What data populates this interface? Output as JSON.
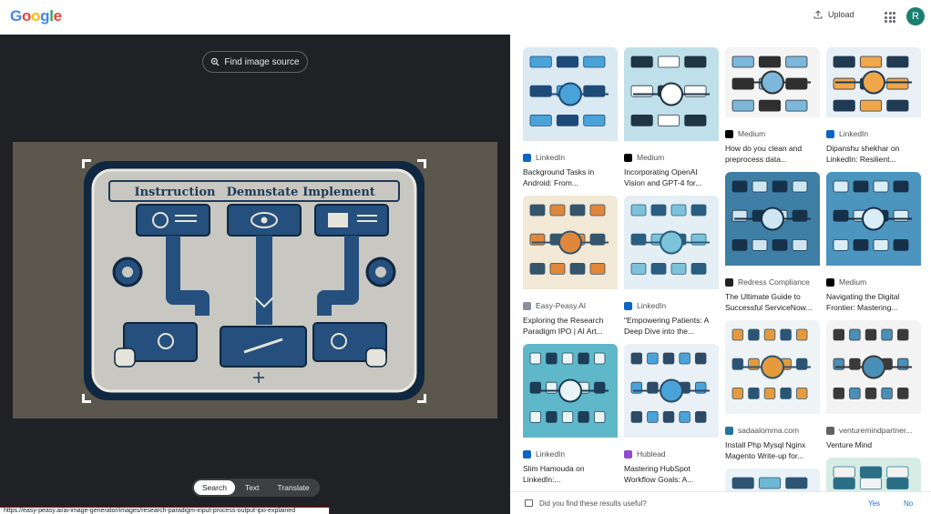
{
  "header": {
    "logo_letters": [
      {
        "ch": "G",
        "color": "#4285f4"
      },
      {
        "ch": "o",
        "color": "#ea4335"
      },
      {
        "ch": "o",
        "color": "#fbbc05"
      },
      {
        "ch": "g",
        "color": "#4285f4"
      },
      {
        "ch": "l",
        "color": "#34a853"
      },
      {
        "ch": "e",
        "color": "#ea4335"
      }
    ],
    "upload_label": "Upload",
    "avatar_letter": "R",
    "avatar_color": "#1a7f6e"
  },
  "left": {
    "find_source_label": "Find image source",
    "image_labels": [
      "Instrruction",
      "Demnstate",
      "Implement"
    ],
    "modes": [
      {
        "label": "Search",
        "active": true
      },
      {
        "label": "Text",
        "active": false
      },
      {
        "label": "Translate",
        "active": false
      }
    ],
    "status_url": "https://easy-peasy.ai/ai-image-generator/images/research-paradigm-input-process-output-ipo-explained"
  },
  "results": {
    "columns": [
      [
        {
          "source": "LinkedIn",
          "source_icon": "linkedin-icon",
          "source_color": "#0a66c2",
          "title": "Background Tasks in Android: From...",
          "thumb_bg": "#dbe9f2",
          "thumb_fg": "#1e4a78",
          "thumb_accent": "#4aa3d8"
        },
        {
          "source": "Easy-Peasy.AI",
          "source_icon": "easy-peasy-icon",
          "source_color": "#8a8f98",
          "title": "Exploring the Research Paradigm IPO | AI Art...",
          "thumb_bg": "#f1e8d6",
          "thumb_fg": "#34556b",
          "thumb_accent": "#e1873a"
        },
        {
          "source": "LinkedIn",
          "source_icon": "linkedin-icon",
          "source_color": "#0a66c2",
          "title": "Slim Hamouda on LinkedIn:...",
          "thumb_bg": "#5fb8c9",
          "thumb_fg": "#1c3d56",
          "thumb_accent": "#e8f4f6"
        }
      ],
      [
        {
          "source": "Medium",
          "source_icon": "medium-icon",
          "source_color": "#000000",
          "title": "Incorporating OpenAI Vision and GPT-4 for...",
          "thumb_bg": "#bfe0ea",
          "thumb_fg": "#1f3444",
          "thumb_accent": "#ffffff"
        },
        {
          "source": "LinkedIn",
          "source_icon": "linkedin-icon",
          "source_color": "#0a66c2",
          "title": "\"Empowering Patients: A Deep Dive into the...",
          "thumb_bg": "#e4eff5",
          "thumb_fg": "#2a5d80",
          "thumb_accent": "#7cc3d9"
        },
        {
          "source": "Hublead",
          "source_icon": "hublead-icon",
          "source_color": "#8f4bd1",
          "title": "Mastering HubSpot Workflow Goals: A...",
          "thumb_bg": "#e9f1f6",
          "thumb_fg": "#2d4a66",
          "thumb_accent": "#4aa3d8"
        }
      ],
      [
        {
          "source": "Medium",
          "source_icon": "medium-icon",
          "source_color": "#000000",
          "title": "How do you clean and preprocess data...",
          "thumb_bg": "#f4f4f4",
          "thumb_fg": "#2f2f2f",
          "thumb_accent": "#7cb7dc"
        },
        {
          "source": "Redress Compliance",
          "source_icon": "redress-icon",
          "source_color": "#202124",
          "title": "The Ultimate Guide to Successful ServiceNow...",
          "thumb_bg": "#3f7fa6",
          "thumb_fg": "#16324a",
          "thumb_accent": "#cfe6f2"
        },
        {
          "source": "sadaalomma.com",
          "source_icon": "wordpress-icon",
          "source_color": "#21759b",
          "title": "Install Php Mysql Nginx Magento Write-up for...",
          "thumb_bg": "#eef3f6",
          "thumb_fg": "#2c5573",
          "thumb_accent": "#e69a3b"
        },
        {
          "source": "",
          "source_icon": "",
          "source_color": "#ffffff",
          "title": "",
          "thumb_bg": "#e9f2f7",
          "thumb_fg": "#2c5573",
          "thumb_accent": "#6fb6d6"
        }
      ],
      [
        {
          "source": "LinkedIn",
          "source_icon": "linkedin-icon",
          "source_color": "#0a66c2",
          "title": "Dipanshu shekhar on LinkedIn: Resilient...",
          "thumb_bg": "#e8f0f5",
          "thumb_fg": "#203a52",
          "thumb_accent": "#f0a64a"
        },
        {
          "source": "Medium",
          "source_icon": "medium-icon",
          "source_color": "#000000",
          "title": "Navigating the Digital Frontier: Mastering...",
          "thumb_bg": "#4b95bf",
          "thumb_fg": "#173049",
          "thumb_accent": "#d9edf6"
        },
        {
          "source": "venturemindpartner...",
          "source_icon": "venture-mind-icon",
          "source_color": "#5f6368",
          "title": "Venture Mind",
          "thumb_bg": "#f3f3f3",
          "thumb_fg": "#3a3a3a",
          "thumb_accent": "#4a8fb8"
        },
        {
          "source": "",
          "source_icon": "",
          "source_color": "#ffffff",
          "title": "",
          "thumb_bg": "#d6ede6",
          "thumb_fg": "#2a6f86",
          "thumb_accent": "#f2f2f2"
        }
      ]
    ],
    "feedback_question": "Did you find these results useful?",
    "feedback_yes": "Yes",
    "feedback_no": "No"
  }
}
